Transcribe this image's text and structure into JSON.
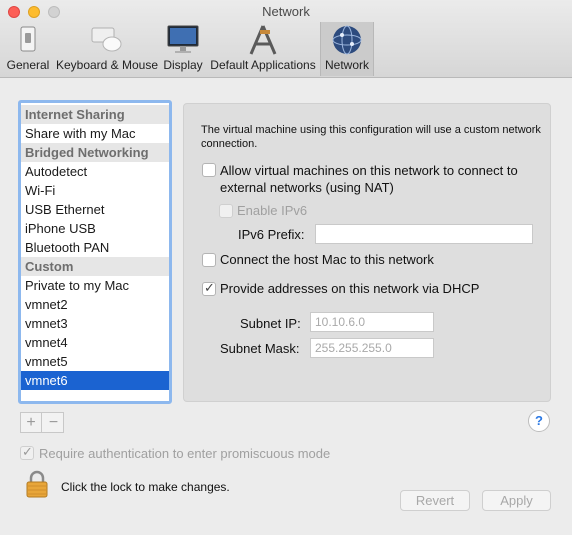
{
  "window": {
    "title": "Network"
  },
  "toolbar": {
    "items": [
      {
        "label": "General",
        "icon": "general-switch-icon"
      },
      {
        "label": "Keyboard & Mouse",
        "icon": "keyboard-mouse-icon"
      },
      {
        "label": "Display",
        "icon": "display-monitor-icon"
      },
      {
        "label": "Default Applications",
        "icon": "default-applications-icon"
      },
      {
        "label": "Network",
        "icon": "network-globe-icon"
      }
    ],
    "selected": "Network"
  },
  "sidebar": {
    "items": [
      {
        "label": "Internet Sharing",
        "type": "header"
      },
      {
        "label": "Share with my Mac",
        "type": "item"
      },
      {
        "label": "Bridged Networking",
        "type": "header"
      },
      {
        "label": "Autodetect",
        "type": "item"
      },
      {
        "label": "Wi-Fi",
        "type": "item"
      },
      {
        "label": "USB Ethernet",
        "type": "item"
      },
      {
        "label": "iPhone USB",
        "type": "item"
      },
      {
        "label": "Bluetooth PAN",
        "type": "item"
      },
      {
        "label": "Custom",
        "type": "header"
      },
      {
        "label": "Private to my Mac",
        "type": "item"
      },
      {
        "label": "vmnet2",
        "type": "item"
      },
      {
        "label": "vmnet3",
        "type": "item"
      },
      {
        "label": "vmnet4",
        "type": "item"
      },
      {
        "label": "vmnet5",
        "type": "item"
      },
      {
        "label": "vmnet6",
        "type": "item",
        "selected": true
      }
    ],
    "add_label": "+",
    "remove_label": "−"
  },
  "panel": {
    "description": "The virtual machine using this configuration will use a custom network connection.",
    "allow_nat_label": "Allow virtual machines on this network to connect to external networks (using NAT)",
    "allow_nat_checked": false,
    "enable_ipv6_label": "Enable IPv6",
    "enable_ipv6_checked": false,
    "ipv6_prefix_label": "IPv6 Prefix:",
    "ipv6_prefix_value": "",
    "connect_host_label": "Connect the host Mac to this network",
    "connect_host_checked": false,
    "dhcp_label": "Provide addresses on this network via DHCP",
    "dhcp_checked": true,
    "subnet_ip_label": "Subnet IP:",
    "subnet_ip_value": "10.10.6.0",
    "subnet_mask_label": "Subnet Mask:",
    "subnet_mask_value": "255.255.255.0"
  },
  "footer": {
    "help_label": "?",
    "promiscuous_label": "Require authentication to enter promiscuous mode",
    "promiscuous_checked": true,
    "lock_text": "Click the lock to make changes.",
    "revert_label": "Revert",
    "apply_label": "Apply"
  },
  "colors": {
    "selection": "#1b63d1",
    "focus_ring": "#8db8ee",
    "close": "#fc5f57",
    "minimize": "#fdbc2e"
  }
}
